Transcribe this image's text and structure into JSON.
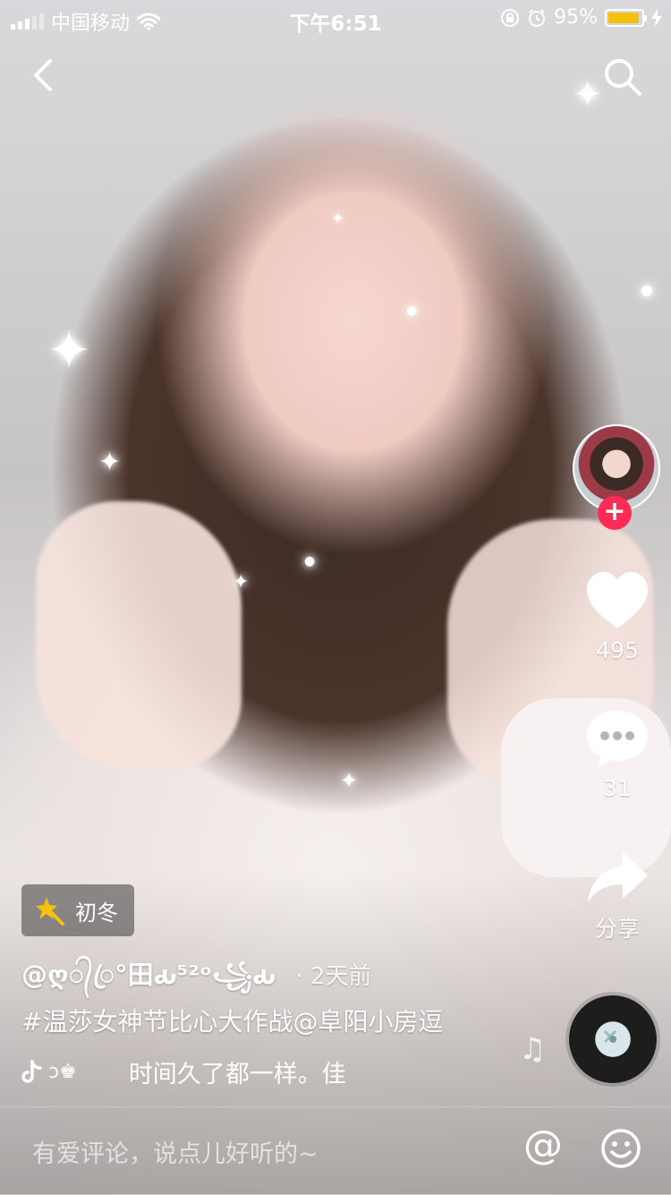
{
  "status_bar": {
    "carrier": "中国移动",
    "time": "下午6:51",
    "battery": "95%",
    "battery_level": 0.95
  },
  "video_info": {
    "sticker_label": "初冬",
    "username": "@ღ᭄ꦿ°田ԃ⁵²ᵒ꧁ԃ",
    "time_ago": "· 2天前",
    "description": "#温莎女神节比心大作战@阜阳小房逗",
    "music_owner": "ↄ♚",
    "music_title": "时间久了都一样。佳"
  },
  "right_rail": {
    "likes": "495",
    "comments": "31",
    "share_label": "分享"
  },
  "comment_bar": {
    "placeholder": "有爱评论，说点儿好听的~",
    "at_symbol": "@"
  },
  "icons": {
    "back": "chevron-left-icon",
    "search": "search-icon",
    "like": "heart-icon",
    "comment": "comment-bubble-icon",
    "share": "share-arrow-icon",
    "follow": "plus-icon",
    "emoji": "smiley-icon",
    "music": "music-note-icon"
  },
  "colors": {
    "follow_red": "#fe2c55",
    "battery_yellow": "#f4c20d"
  }
}
